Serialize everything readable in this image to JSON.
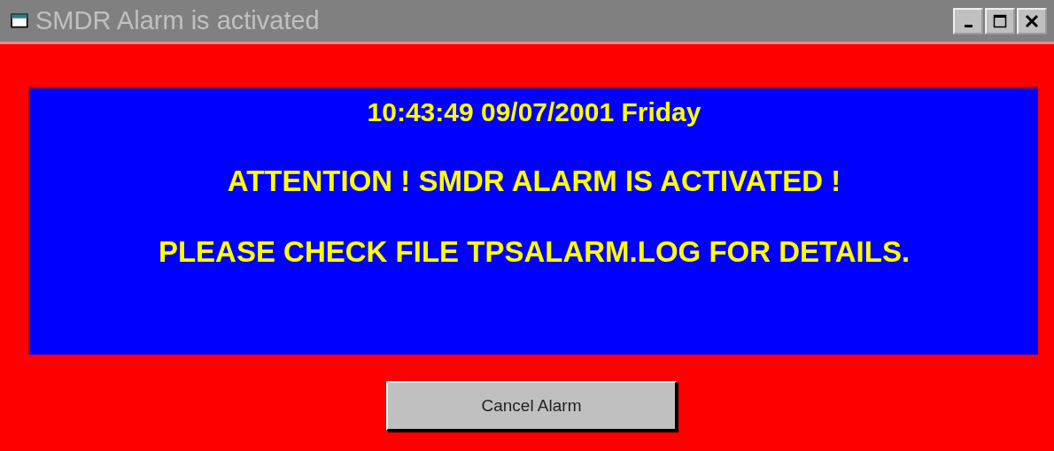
{
  "window": {
    "title": "SMDR Alarm is activated"
  },
  "alarm": {
    "lines": [
      "10:43:49 09/07/2001 Friday",
      "ATTENTION ! SMDR ALARM IS ACTIVATED !",
      "PLEASE CHECK FILE TPSALARM.LOG FOR DETAILS."
    ]
  },
  "buttons": [
    "Cancel Alarm"
  ]
}
